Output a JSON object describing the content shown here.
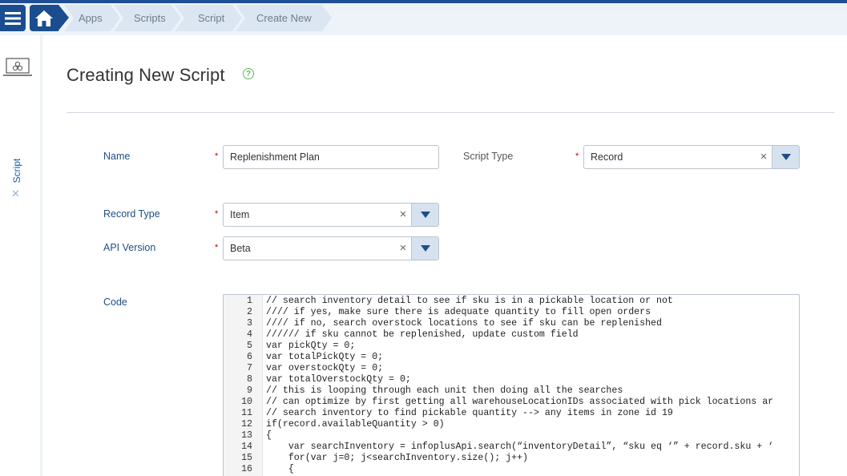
{
  "breadcrumb": {
    "items": [
      "Apps",
      "Scripts",
      "Script",
      "Create New"
    ]
  },
  "sidebar": {
    "tab_label": "Script",
    "close_glyph": "✕"
  },
  "page": {
    "title": "Creating New Script",
    "help_glyph": "?"
  },
  "form": {
    "name_label": "Name",
    "name_value": "Replenishment Plan",
    "script_type_label": "Script Type",
    "script_type_value": "Record",
    "record_type_label": "Record Type",
    "record_type_value": "Item",
    "api_version_label": "API Version",
    "api_version_value": "Beta",
    "code_label": "Code",
    "required_mark": "*",
    "clear_glyph": "×"
  },
  "code": {
    "lines": [
      {
        "n": "1",
        "text": "// search inventory detail to see if sku is in a pickable location or not"
      },
      {
        "n": "2",
        "text": "//// if yes, make sure there is adequate quantity to fill open orders"
      },
      {
        "n": "3",
        "text": "//// if no, search overstock locations to see if sku can be replenished"
      },
      {
        "n": "4",
        "text": "////// if sku cannot be replenished, update custom field"
      },
      {
        "n": "5",
        "text": "var pickQty = 0;"
      },
      {
        "n": "6",
        "text": "var totalPickQty = 0;"
      },
      {
        "n": "7",
        "text": "var overstockQty = 0;"
      },
      {
        "n": "8",
        "text": "var totalOverstockQty = 0;"
      },
      {
        "n": "9",
        "text": "// this is looping through each unit then doing all the searches"
      },
      {
        "n": "10",
        "text": "// can optimize by first getting all warehouseLocationIDs associated with pick locations ar"
      },
      {
        "n": "11",
        "text": "// search inventory to find pickable quantity --> any items in zone id 19"
      },
      {
        "n": "12",
        "text": "if(record.availableQuantity > 0)"
      },
      {
        "n": "13",
        "text": "{"
      },
      {
        "n": "14",
        "text": "    var searchInventory = infoplusApi.search(“inventoryDetail”, “sku eq ‘” + record.sku + ‘"
      },
      {
        "n": "15",
        "text": "    for(var j=0; j<searchInventory.size(); j++)"
      },
      {
        "n": "16",
        "text": "    {"
      }
    ]
  },
  "colors": {
    "brand": "#1a4d8f",
    "breadcrumb_bg": "#dbe6f2",
    "label_blue": "#1f4e85",
    "required_red": "#cc0000",
    "help_green": "#5cb85c"
  },
  "icons": [
    "menu-icon",
    "home-icon",
    "laptop-icon",
    "help-icon",
    "close-icon",
    "clear-icon",
    "chevron-down-icon"
  ]
}
